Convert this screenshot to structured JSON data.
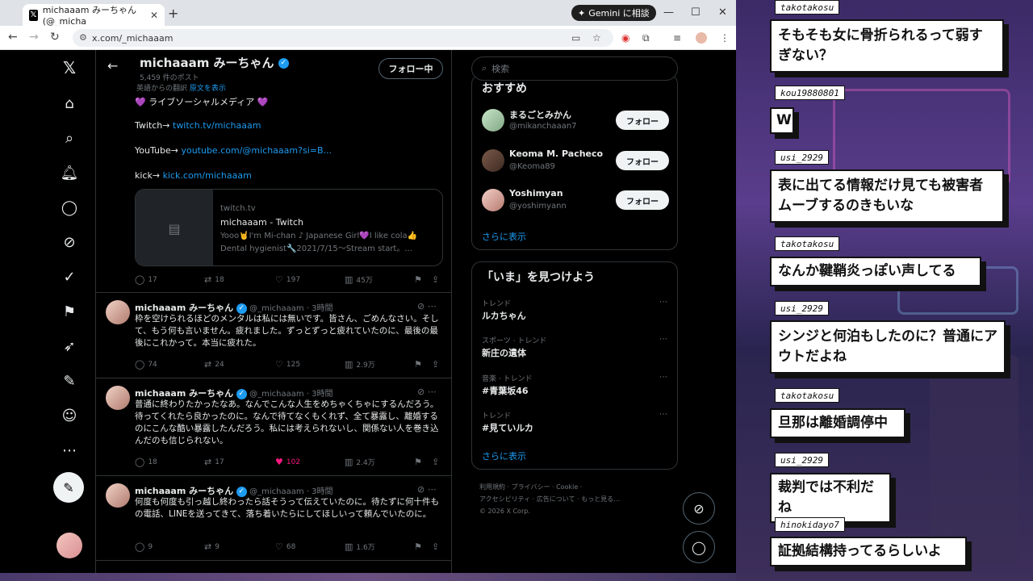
{
  "browser": {
    "tab_title": "michaaam みーちゃん (@_micha",
    "gemini_label": "Gemini に相談",
    "url": "x.com/_michaaam"
  },
  "profile": {
    "name": "michaaam みーちゃん",
    "post_count": "5,459 件のポスト",
    "following_label": "フォロー中",
    "translated_from": "英語からの翻訳",
    "show_original": "原文を表示",
    "bio": [
      {
        "prefix": "💜 ライブソーシャルメディア 💜",
        "link": ""
      },
      {
        "prefix": "Twitch→ ",
        "link": "twitch.tv/michaaam"
      },
      {
        "prefix": "YouTube→ ",
        "link": "youtube.com/@michaaam?si=B..."
      },
      {
        "prefix": "kick→ ",
        "link": "kick.com/michaaam"
      }
    ],
    "card": {
      "domain": "twitch.tv",
      "title": "michaaam - Twitch",
      "desc": "Yooo🤘I'm Mi-chan ♪ Japanese Girl💜I like cola👍 Dental hygienist🔧2021/7/15〜Stream start。..."
    },
    "stats": {
      "replies": "17",
      "reposts": "18",
      "likes": "197",
      "views": "45万"
    }
  },
  "tweets": [
    {
      "name": "michaaam みーちゃん",
      "handle": "@_michaaam · 3時間",
      "text": "枠を空けられるほどのメンタルは私には無いです。皆さん、ごめんなさい。そして、もう何も言いません。疲れました。ずっとずっと疲れていたのに、最後の最後にこれかって。本当に疲れた。",
      "replies": "74",
      "reposts": "24",
      "likes": "125",
      "views": "2.9万"
    },
    {
      "name": "michaaam みーちゃん",
      "handle": "@_michaaam · 3時間",
      "text": "普通に終わりたかったなあ。なんでこんな人生をめちゃくちゃにするんだろう。待ってくれたら良かったのに。なんで待てなくもくれず、全て暴露し、離婚するのにこんな酷い暴露したんだろう。私には考えられないし、関係ない人を巻き込んだのも信じられない。",
      "replies": "18",
      "reposts": "17",
      "likes": "102",
      "views": "2.4万"
    },
    {
      "name": "michaaam みーちゃん",
      "handle": "@_michaaam · 3時間",
      "text": "何度も何度も引っ越し終わったら話そうって伝えていたのに。待たずに何十件もの電話、LINEを送ってきて、落ち着いたらにしてほしいって頼んでいたのに。",
      "replies": "9",
      "reposts": "9",
      "likes": "68",
      "views": "1.6万"
    }
  ],
  "sidebar": {
    "search_placeholder": "検索",
    "suggest_title": "おすすめ",
    "suggestions": [
      {
        "name": "まるごとみかん",
        "handle": "@mikanchaaan7",
        "follow": "フォロー"
      },
      {
        "name": "Keoma M. Pacheco",
        "handle": "@Keoma89",
        "follow": "フォロー"
      },
      {
        "name": "Yoshimyan",
        "handle": "@yoshimyann",
        "follow": "フォロー"
      }
    ],
    "show_more": "さらに表示",
    "trends_title": "「いま」を見つけよう",
    "trends": [
      {
        "category": "トレンド",
        "name": "ルカちゃん"
      },
      {
        "category": "スポーツ · トレンド",
        "name": "新庄の遺体"
      },
      {
        "category": "音楽 · トレンド",
        "name": "#青葉坂46"
      },
      {
        "category": "トレンド",
        "name": "#見ていルカ"
      }
    ],
    "show_more_2": "さらに表示",
    "footer_line1": "利用規約 · プライバシー · Cookie ·",
    "footer_line2": "アクセシビリティ · 広告について · もっと見る…",
    "footer_line3": "© 2026 X Corp."
  },
  "chat": [
    {
      "user": "takotakosu",
      "text": "そもそも女に骨折られるって弱すぎない？"
    },
    {
      "user": "kou19880801",
      "text": "W"
    },
    {
      "user": "usi_2929",
      "text": "表に出てる情報だけ見ても被害者ムーブするのきもいな"
    },
    {
      "user": "takotakosu",
      "text": "なんか鞬鞘炎っぽい声してる"
    },
    {
      "user": "usi_2929",
      "text": "シンジと何泊もしたのに？普通にアウトだよね"
    },
    {
      "user": "takotakosu",
      "text": "旦那は離婚調停中"
    },
    {
      "user": "usi_2929",
      "text": "裁判では不利だね"
    },
    {
      "user": "hinokidayo7",
      "text": "証拠結構持ってるらしいよ"
    }
  ]
}
